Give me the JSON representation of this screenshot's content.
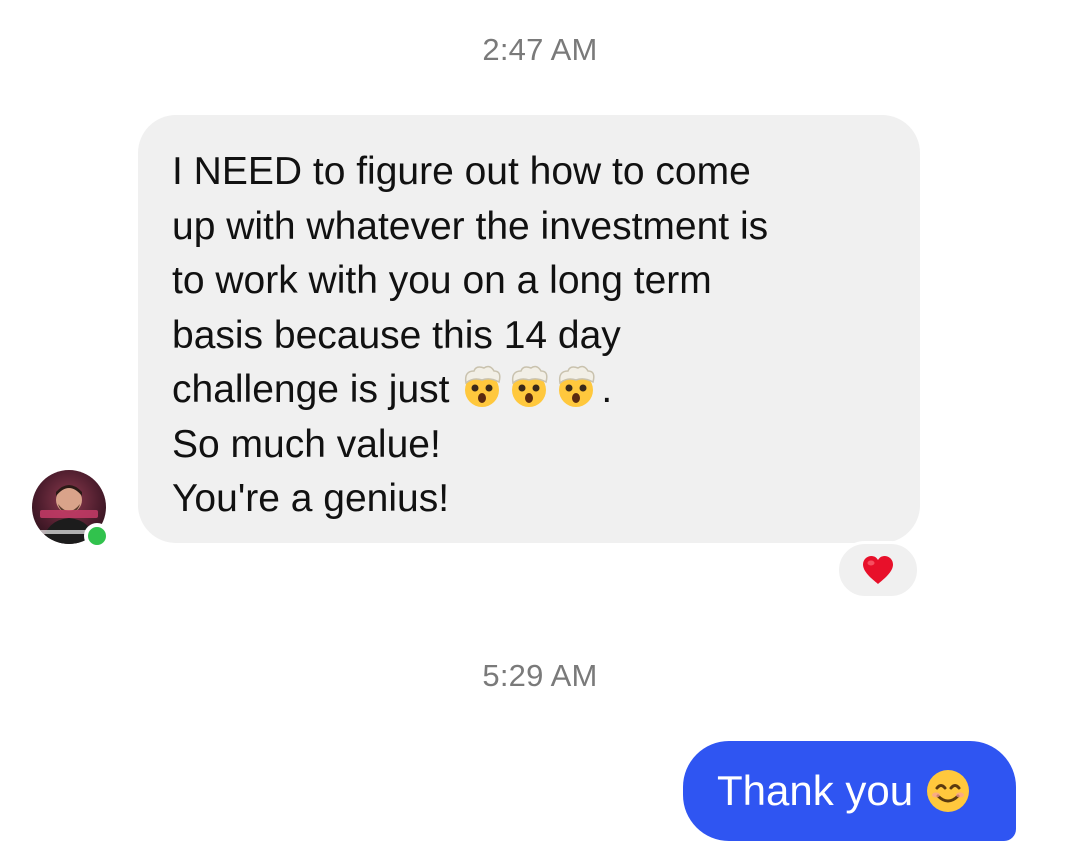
{
  "conversation": {
    "timestamp_1": "2:47 AM",
    "incoming_message": {
      "lines": [
        "I NEED to figure out how to come",
        "up with whatever the investment is",
        "to work with you on a long term",
        "basis because this 14 day",
        "challenge is just",
        ".",
        "So much value!",
        "You're a genius!"
      ],
      "emojis": [
        "exploding-head-emoji",
        "exploding-head-emoji",
        "exploding-head-emoji"
      ],
      "reaction": "heart-icon"
    },
    "timestamp_2": "5:29 AM",
    "outgoing_message": {
      "text": "Thank you",
      "emoji": "smiling-face-emoji"
    }
  },
  "colors": {
    "incoming_bubble": "#f0f0f0",
    "outgoing_bubble": "#2f55f2",
    "timestamp_text": "#7a7a7a",
    "online_status": "#31c24d",
    "reaction_heart": "#e8102a"
  }
}
